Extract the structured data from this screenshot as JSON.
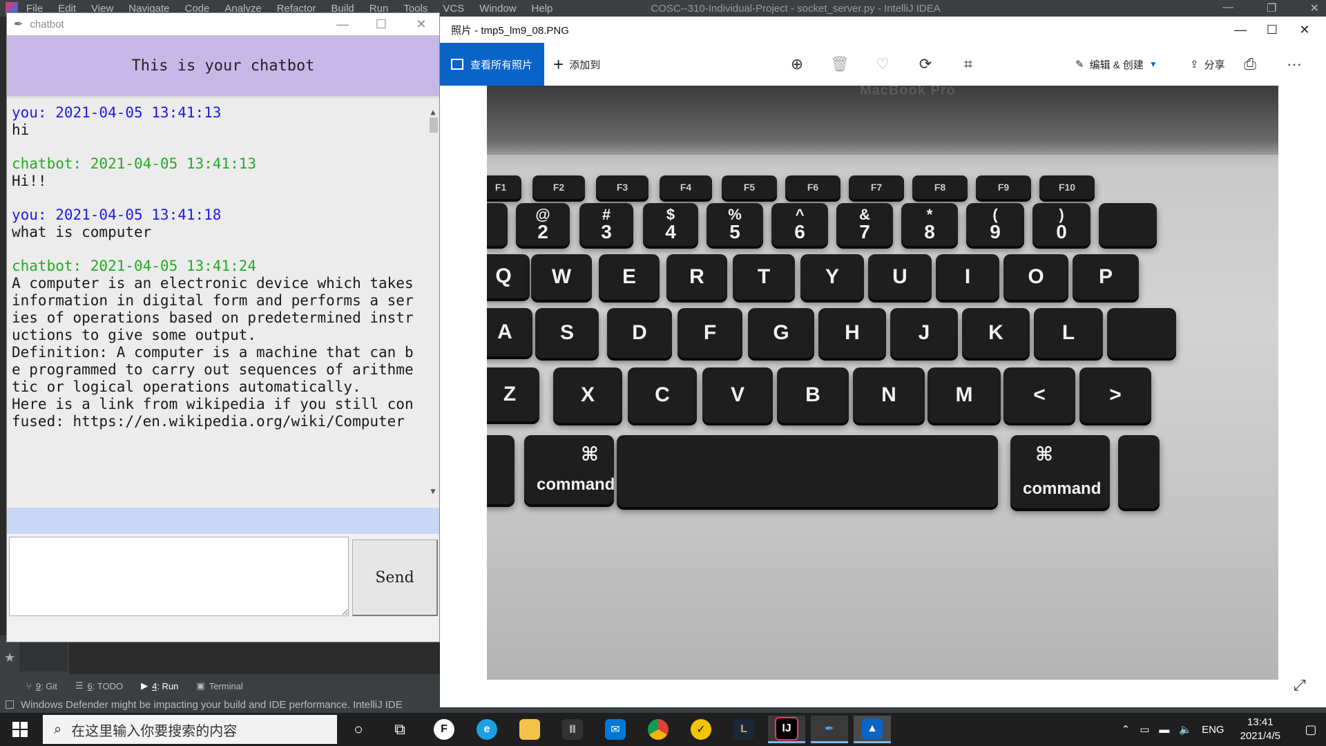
{
  "ide": {
    "menu": [
      "File",
      "Edit",
      "View",
      "Navigate",
      "Code",
      "Analyze",
      "Refactor",
      "Build",
      "Run",
      "Tools",
      "VCS",
      "Window",
      "Help"
    ],
    "title": "COSC--310-Individual-Project - socket_server.py - IntelliJ IDEA",
    "toolwindows": [
      {
        "num": "9",
        "label": ": Git"
      },
      {
        "num": "6",
        "label": ": TODO"
      },
      {
        "num": "4",
        "label": ": Run"
      },
      {
        "num": "",
        "label": "Terminal"
      }
    ],
    "status_message": "Windows Defender might be impacting your build and IDE performance. IntelliJ IDE"
  },
  "chatbot": {
    "window_title": "chatbot",
    "header": "This is your chatbot",
    "messages": [
      {
        "role": "you",
        "head": "you: 2021-04-05 13:41:13",
        "text": "hi"
      },
      {
        "role": "bot",
        "head": "chatbot: 2021-04-05 13:41:13",
        "text": "Hi!!"
      },
      {
        "role": "you",
        "head": "you: 2021-04-05 13:41:18",
        "text": "what is computer"
      },
      {
        "role": "bot",
        "head": "chatbot: 2021-04-05 13:41:24",
        "text": "A computer is an electronic device which takes information in digital form and performs a series of operations based on predetermined instructions to give some output.\nDefinition: A computer is a machine that can be programmed to carry out sequences of arithmetic or logical operations automatically.\nHere is a link from wikipedia if you still confused: https://en.wikipedia.org/wiki/Computer"
      }
    ],
    "input_value": "",
    "send_label": "Send"
  },
  "photos": {
    "window_title": "照片 - tmp5_lm9_08.PNG",
    "see_all_label": "查看所有照片",
    "add_to_label": "添加到",
    "edit_create_label": "编辑 & 创建",
    "share_label": "分享",
    "more_label": "···",
    "image_content": {
      "brand": "MacBook Pro",
      "fn_keys": [
        "F1",
        "F2",
        "F3",
        "F4",
        "F5",
        "F6",
        "F7",
        "F8",
        "F9",
        "F10"
      ],
      "number_keys": [
        [
          "@",
          "2"
        ],
        [
          "#",
          "3"
        ],
        [
          "$",
          "4"
        ],
        [
          "%",
          "5"
        ],
        [
          "^",
          "6"
        ],
        [
          "&",
          "7"
        ],
        [
          "*",
          "8"
        ],
        [
          "(",
          "9"
        ],
        [
          ")",
          "0"
        ]
      ],
      "row_q": [
        "Q",
        "W",
        "E",
        "R",
        "T",
        "Y",
        "U",
        "I",
        "O",
        "P"
      ],
      "row_a": [
        "A",
        "S",
        "D",
        "F",
        "G",
        "H",
        "J",
        "K",
        "L"
      ],
      "row_z": [
        "Z",
        "X",
        "C",
        "V",
        "B",
        "N",
        "M",
        "<",
        ">"
      ],
      "command_label": "command"
    }
  },
  "taskbar": {
    "search_placeholder": "在这里输入你要搜索的内容",
    "language": "ENG",
    "time": "13:41",
    "date": "2021/4/5"
  }
}
